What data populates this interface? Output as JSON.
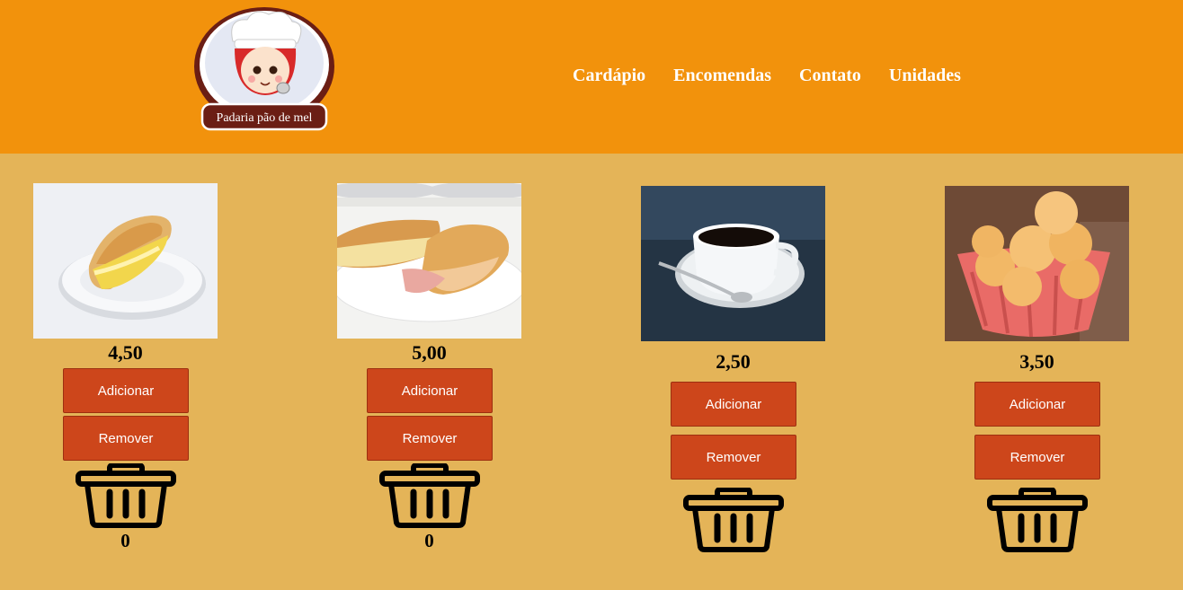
{
  "header": {
    "logo_text": "Padaria pão de mel",
    "nav": [
      "Cardápio",
      "Encomendas",
      "Contato",
      "Unidades"
    ]
  },
  "products": [
    {
      "image": "egg-sandwich-photo",
      "price": "4,50",
      "add_label": "Adicionar",
      "remove_label": "Remover",
      "quantity": "0"
    },
    {
      "image": "ham-cheese-sandwich-photo",
      "price": "5,00",
      "add_label": "Adicionar",
      "remove_label": "Remover",
      "quantity": "0"
    },
    {
      "image": "coffee-cup-photo",
      "price": "2,50",
      "add_label": "Adicionar",
      "remove_label": "Remover",
      "quantity": ""
    },
    {
      "image": "cheese-bread-photo",
      "price": "3,50",
      "add_label": "Adicionar",
      "remove_label": "Remover",
      "quantity": ""
    }
  ],
  "colors": {
    "header": "#f2920c",
    "background": "#e4b458",
    "button": "#cd461b"
  }
}
